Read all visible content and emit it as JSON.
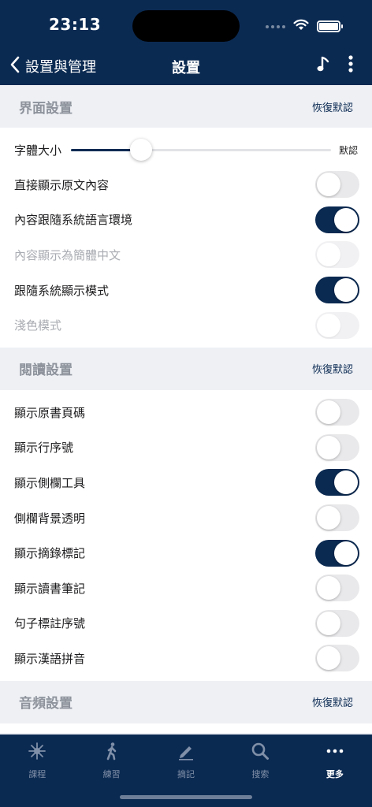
{
  "status": {
    "time": "23:13"
  },
  "nav": {
    "back_label": "設置與管理",
    "title": "設置"
  },
  "sections": [
    {
      "title": "界面設置",
      "reset_label": "恢復默認",
      "font_size": {
        "label": "字體大小",
        "end_label": "默認",
        "value": 0.27
      },
      "items": [
        {
          "label": "直接顯示原文內容",
          "state": "off",
          "disabled": false
        },
        {
          "label": "內容跟隨系統語言環境",
          "state": "on",
          "disabled": false
        },
        {
          "label": "內容顯示為簡體中文",
          "state": "off",
          "disabled": true
        },
        {
          "label": "跟隨系統顯示模式",
          "state": "on",
          "disabled": false
        },
        {
          "label": "淺色模式",
          "state": "off",
          "disabled": true
        }
      ]
    },
    {
      "title": "閱讀設置",
      "reset_label": "恢復默認",
      "items": [
        {
          "label": "顯示原書頁碼",
          "state": "off",
          "disabled": false
        },
        {
          "label": "顯示行序號",
          "state": "off",
          "disabled": false
        },
        {
          "label": "顯示側欄工具",
          "state": "on",
          "disabled": false
        },
        {
          "label": "側欄背景透明",
          "state": "off",
          "disabled": false
        },
        {
          "label": "顯示摘錄標記",
          "state": "on",
          "disabled": false
        },
        {
          "label": "顯示讀書筆記",
          "state": "off",
          "disabled": false
        },
        {
          "label": "句子標註序號",
          "state": "off",
          "disabled": false
        },
        {
          "label": "顯示漢語拼音",
          "state": "off",
          "disabled": false
        }
      ]
    },
    {
      "title": "音頻設置",
      "reset_label": "恢復默認"
    }
  ],
  "tabs": [
    {
      "label": "課程",
      "icon": "sparkle-icon",
      "active": false
    },
    {
      "label": "練習",
      "icon": "walking-icon",
      "active": false
    },
    {
      "label": "摘記",
      "icon": "pencil-icon",
      "active": false
    },
    {
      "label": "搜索",
      "icon": "search-icon",
      "active": false
    },
    {
      "label": "更多",
      "icon": "more-icon",
      "active": true
    }
  ],
  "colors": {
    "primary": "#0b2a52",
    "background": "#eef0f4",
    "toggle_off": "#e9e9eb"
  }
}
